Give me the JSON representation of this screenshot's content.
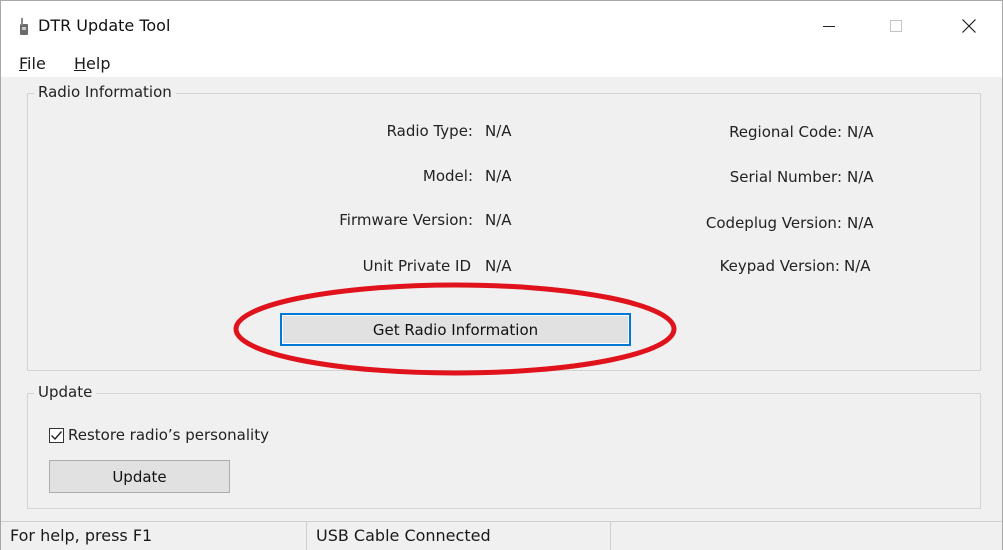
{
  "window": {
    "title": "DTR Update Tool",
    "icon": "radio-app-icon",
    "controls": [
      "minimize-icon",
      "maximize-icon",
      "close-icon"
    ]
  },
  "menu": {
    "file_rest": "ile",
    "file_accel": "F",
    "help_rest": "elp",
    "help_accel": "H"
  },
  "radio_info": {
    "group_label": "Radio Information",
    "fields_left": [
      {
        "label": "Radio Type:",
        "value": "N/A"
      },
      {
        "label": "Model:",
        "value": "N/A"
      },
      {
        "label": "Firmware Version:",
        "value": "N/A"
      },
      {
        "label": "Unit Private ID",
        "value": "N/A"
      }
    ],
    "fields_right": [
      {
        "label": "Regional Code:",
        "value": "N/A"
      },
      {
        "label": "Serial Number:",
        "value": "N/A"
      },
      {
        "label": "Codeplug Version:",
        "value": "N/A"
      },
      {
        "label": "Keypad Version:",
        "value": "N/A"
      }
    ],
    "get_info_button": "Get Radio Information",
    "highlight_color": "#e0131d"
  },
  "update": {
    "group_label": "Update",
    "restore_checkbox_label": "Restore radio’s personality",
    "restore_checked": true,
    "update_button": "Update"
  },
  "status_bar": {
    "help_text": "For help, press F1",
    "connection_text": "USB Cable Connected"
  }
}
